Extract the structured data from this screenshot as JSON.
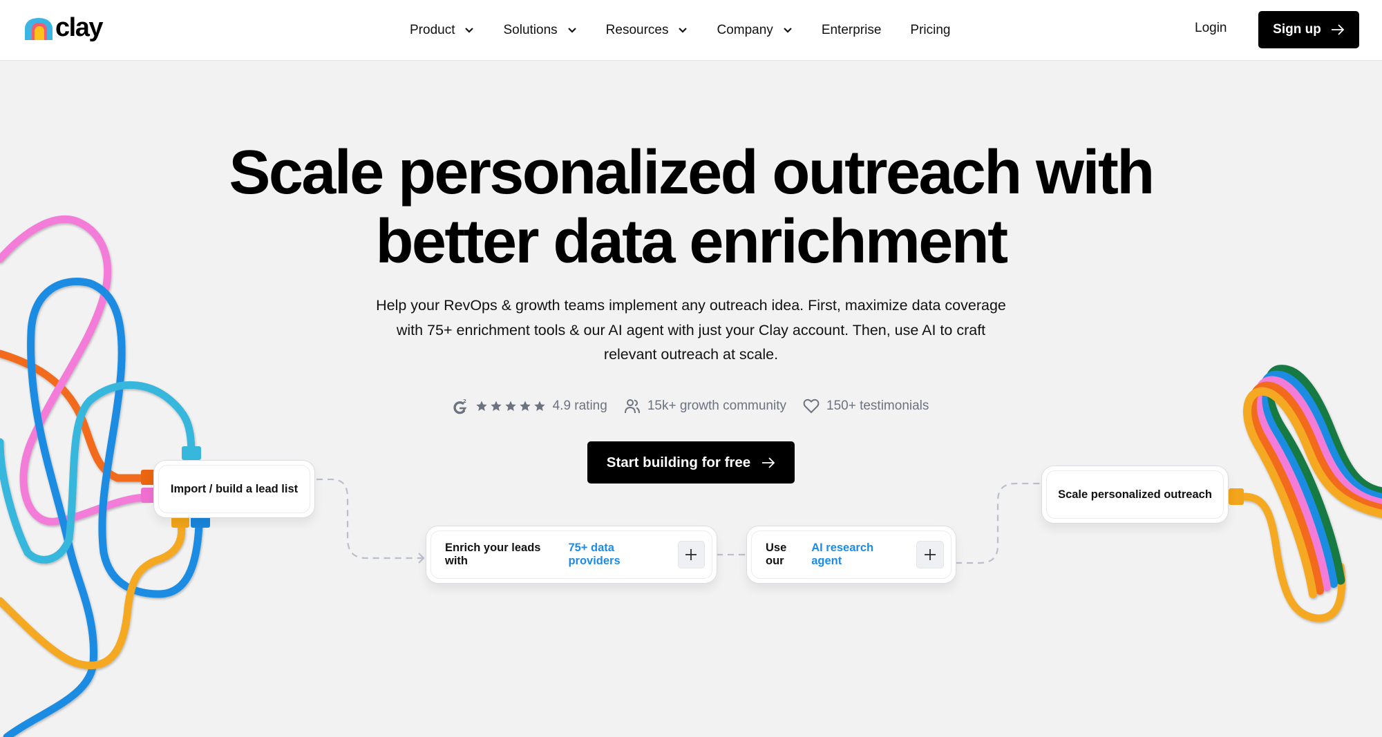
{
  "header": {
    "brand": "clay",
    "nav": [
      {
        "label": "Product",
        "has_dropdown": true
      },
      {
        "label": "Solutions",
        "has_dropdown": true
      },
      {
        "label": "Resources",
        "has_dropdown": true
      },
      {
        "label": "Company",
        "has_dropdown": true
      },
      {
        "label": "Enterprise",
        "has_dropdown": false
      },
      {
        "label": "Pricing",
        "has_dropdown": false
      }
    ],
    "login_label": "Login",
    "signup_label": "Sign up"
  },
  "hero": {
    "title_line1": "Scale personalized outreach with",
    "title_line2": "better data enrichment",
    "subtitle_line1": "Help your RevOps & growth teams implement any outreach idea. First, maximize data coverage",
    "subtitle_line2": "with 75+ enrichment tools & our AI agent with just your Clay account. Then, use AI to craft",
    "subtitle_line3": "relevant outreach at scale.",
    "stats": {
      "rating_icon": "g2-icon",
      "rating_stars": 5,
      "rating_label": "4.9 rating",
      "community_icon": "users-icon",
      "community_label": "15k+ growth community",
      "testimonials_icon": "heart-icon",
      "testimonials_label": "150+ testimonials"
    },
    "cta_label": "Start building for free"
  },
  "workflow": {
    "step1": {
      "label": "Import / build a lead list"
    },
    "step2": {
      "prefix": "Enrich your leads with",
      "highlight": "75+ data providers"
    },
    "step3": {
      "prefix": "Use our",
      "highlight": "AI research agent"
    },
    "step4": {
      "label": "Scale personalized outreach"
    }
  },
  "colors": {
    "accent_link": "#1b8ce8",
    "cta_bg": "#000000",
    "stats_text": "#6b7280",
    "page_bg": "#f2f2f2"
  }
}
